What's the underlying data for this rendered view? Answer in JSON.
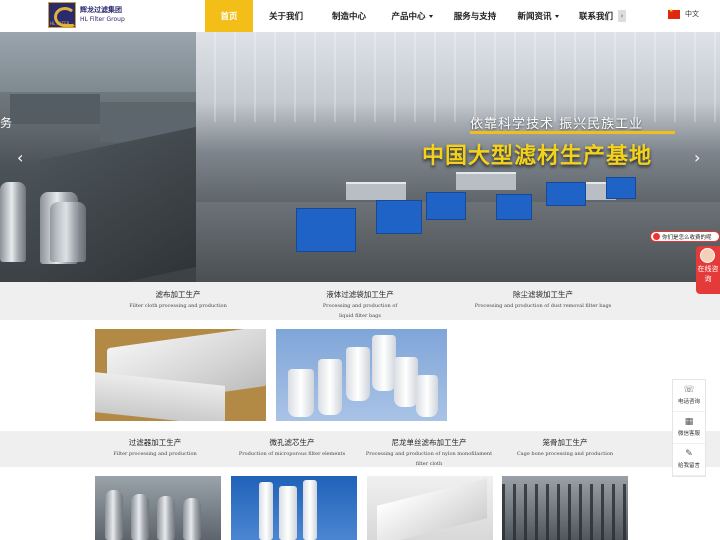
{
  "header": {
    "logo": {
      "name_cn": "辉龙过滤集团",
      "name_en": "HL Filter Group",
      "mark_text": "HL FILTER"
    },
    "nav": [
      {
        "label": "首页",
        "active": true,
        "dropdown": false
      },
      {
        "label": "关于我们",
        "active": false,
        "dropdown": false
      },
      {
        "label": "制造中心",
        "active": false,
        "dropdown": false
      },
      {
        "label": "产品中心",
        "active": false,
        "dropdown": true
      },
      {
        "label": "服务与支持",
        "active": false,
        "dropdown": false
      },
      {
        "label": "新闻资讯",
        "active": false,
        "dropdown": true
      },
      {
        "label": "联系我们",
        "active": false,
        "dropdown": false
      }
    ],
    "nav_more_icon": "›",
    "language": "中文"
  },
  "hero": {
    "left_partial_text": "务",
    "subtitle": "依靠科学技术 振兴民族工业",
    "title": "中国大型滤材生产基地",
    "prev_icon": "‹",
    "next_icon": "›"
  },
  "categories_row1": [
    {
      "cn": "滤布加工生产",
      "en": "Filter cloth processing and production"
    },
    {
      "cn": "液体过滤袋加工生产",
      "en": "Processing and production of liquid filter bags"
    },
    {
      "cn": "除尘滤袋加工生产",
      "en": "Processing and production of dust removal filter bags"
    }
  ],
  "categories_row2": [
    {
      "cn": "过滤器加工生产",
      "en": "Filter processing and production"
    },
    {
      "cn": "微孔滤芯生产",
      "en": "Production of microporous filter elements"
    },
    {
      "cn": "尼龙单丝滤布加工生产",
      "en": "Processing and production of nylon monofilament filter cloth"
    },
    {
      "cn": "笼骨加工生产",
      "en": "Cage bone processing and production"
    }
  ],
  "side": {
    "consult_bubble": "你们是怎么收费的呢",
    "online_tab": "在线咨询",
    "tools": [
      {
        "icon": "☏",
        "label": "电话咨询"
      },
      {
        "icon": "▦",
        "label": "微信客服"
      },
      {
        "icon": "✎",
        "label": "给我留言"
      }
    ]
  }
}
